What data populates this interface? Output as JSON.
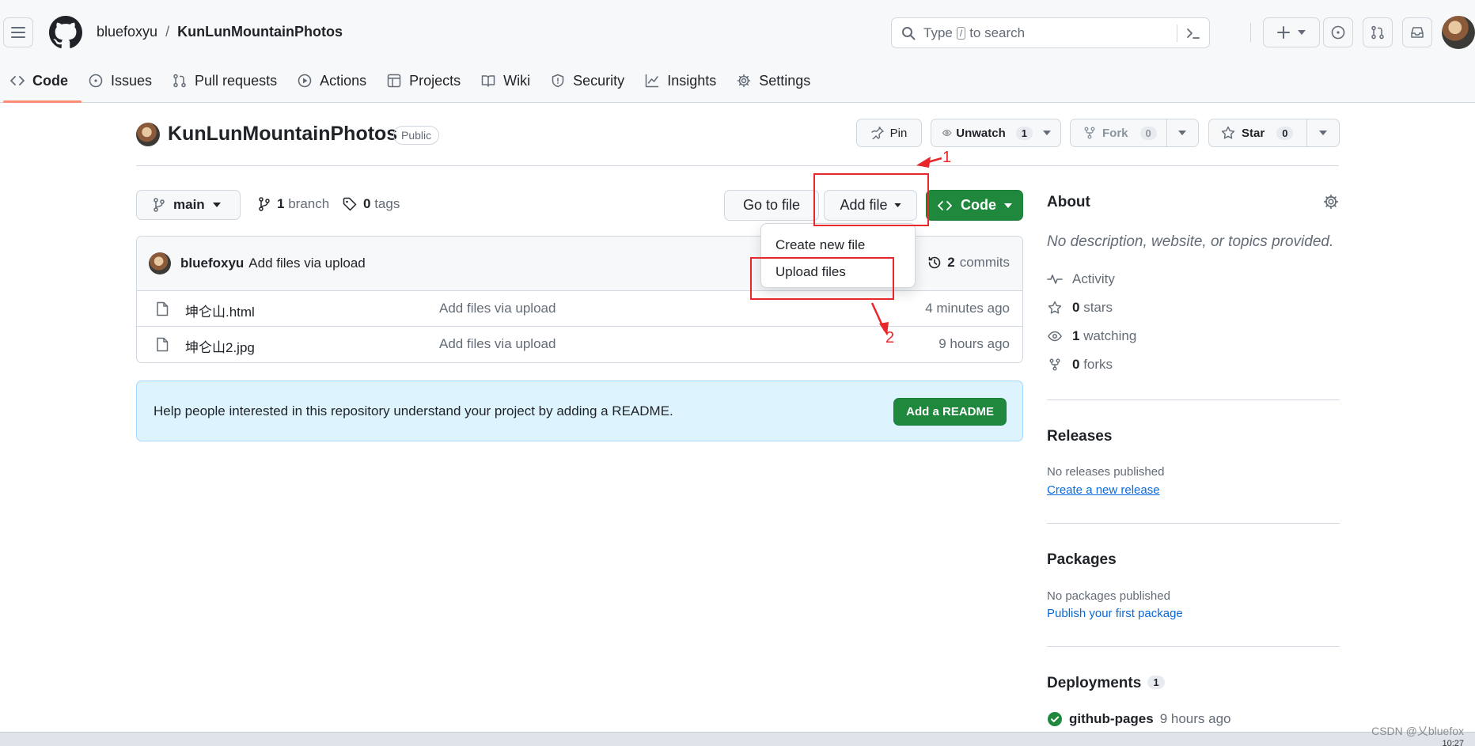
{
  "header": {
    "owner": "bluefoxyu",
    "separator": "/",
    "repo": "KunLunMountainPhotos",
    "search_prefix": "Type",
    "search_key": "/",
    "search_suffix": "to search"
  },
  "tabs": [
    {
      "label": "Code",
      "icon": "code-icon"
    },
    {
      "label": "Issues",
      "icon": "issue-icon"
    },
    {
      "label": "Pull requests",
      "icon": "pull-request-icon"
    },
    {
      "label": "Actions",
      "icon": "play-icon"
    },
    {
      "label": "Projects",
      "icon": "table-icon"
    },
    {
      "label": "Wiki",
      "icon": "book-icon"
    },
    {
      "label": "Security",
      "icon": "shield-icon"
    },
    {
      "label": "Insights",
      "icon": "graph-icon"
    },
    {
      "label": "Settings",
      "icon": "gear-icon"
    }
  ],
  "repo_title": {
    "name": "KunLunMountainPhotos",
    "visibility": "Public",
    "pin_label": "Pin",
    "unwatch_label": "Unwatch",
    "unwatch_count": "1",
    "fork_label": "Fork",
    "fork_count": "0",
    "star_label": "Star",
    "star_count": "0"
  },
  "branch_bar": {
    "branch": "main",
    "branch_count": "1",
    "branch_word": "branch",
    "tag_count": "0",
    "tag_word": "tags",
    "goto_label": "Go to file",
    "addfile_label": "Add file",
    "code_label": "Code"
  },
  "add_file_menu": {
    "items": [
      "Create new file",
      "Upload files"
    ]
  },
  "latest_commit": {
    "author": "bluefoxyu",
    "message": "Add files via upload",
    "commit_count": "2",
    "commit_word": "commits"
  },
  "files": [
    {
      "name": "坤仑山.html",
      "message": "Add files via upload",
      "age": "4 minutes ago"
    },
    {
      "name": "坤仑山2.jpg",
      "message": "Add files via upload",
      "age": "9 hours ago"
    }
  ],
  "readme_banner": {
    "text": "Help people interested in this repository understand your project by adding a README.",
    "button": "Add a README"
  },
  "sidebar": {
    "about_title": "About",
    "about_desc": "No description, website, or topics provided.",
    "activity_label": "Activity",
    "stars_count": "0",
    "stars_word": "stars",
    "watching_count": "1",
    "watching_word": "watching",
    "forks_count": "0",
    "forks_word": "forks",
    "releases_title": "Releases",
    "releases_none": "No releases published",
    "releases_link": "Create a new release",
    "packages_title": "Packages",
    "packages_none": "No packages published",
    "packages_link": "Publish your first package",
    "deployments_title": "Deployments",
    "deployments_count": "1",
    "deploy_name": "github-pages",
    "deploy_age": "9 hours ago"
  },
  "annotations": {
    "label_1": "1",
    "label_2": "2",
    "color": "#e8272b"
  },
  "overlay": {
    "watermark": "CSDN @乂bluefox",
    "clock": "10:27"
  },
  "colors": {
    "accent_green": "#1f883d",
    "link_blue": "#0969da",
    "tab_underline": "#fd8c73",
    "banner_bg": "#ddf4ff"
  }
}
